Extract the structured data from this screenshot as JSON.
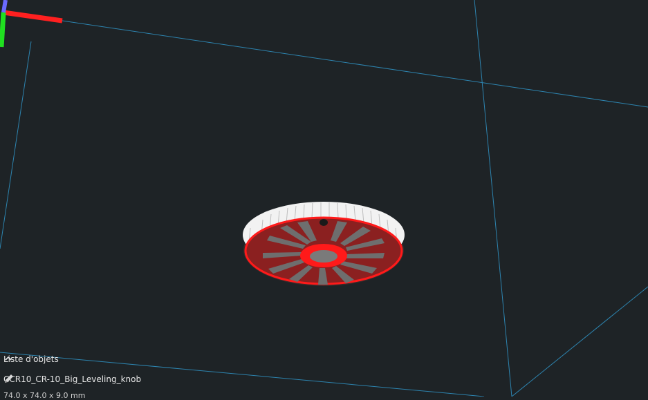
{
  "viewport": {
    "background": "#1e2326",
    "grid_color": "#2f8fbf",
    "axis_colors": {
      "x": "#ff2020",
      "y": "#20e020",
      "z": "#6a6aff"
    },
    "model_colors": {
      "face": "#8b2020",
      "rim": "#ffffff",
      "highlight": "#ff1a1a",
      "spoke": "#6e6e6e"
    }
  },
  "object_list": {
    "header_label": "Liste d'objets",
    "collapse_icon": "chevron-up-icon",
    "edit_icon": "pencil-icon",
    "object_name": "CCR10_CR-10_Big_Leveling_knob",
    "dimensions": "74.0 x 74.0 x 9.0 mm"
  }
}
